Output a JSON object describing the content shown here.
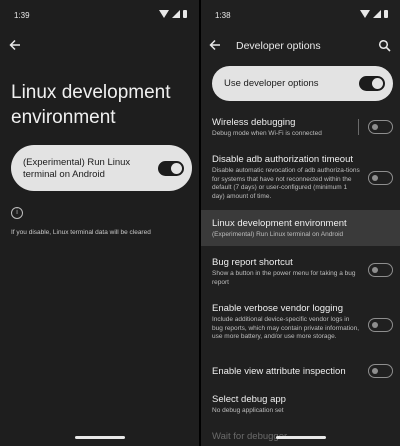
{
  "left": {
    "status_time": "1:39",
    "title": "Linux development environment",
    "toggle_label": "(Experimental) Run Linux terminal on Android",
    "info_text": "If you disable, Linux terminal data will be cleared"
  },
  "right": {
    "status_time": "1:38",
    "title": "Developer options",
    "dev_toggle_label": "Use developer options",
    "items": [
      {
        "title": "Wireless debugging",
        "subtitle": "Debug mode when Wi-Fi is connected"
      },
      {
        "title": "Disable adb authorization timeout",
        "subtitle": "Disable automatic revocation of adb authoriza-tions for systems that have not reconnected within the default (7 days) or user-configured (minimum 1 day) amount of time."
      },
      {
        "title": "Linux development environment",
        "subtitle": "(Experimental) Run Linux terminal on Android"
      },
      {
        "title": "Bug report shortcut",
        "subtitle": "Show a button in the power menu for taking a bug report"
      },
      {
        "title": "Enable verbose vendor logging",
        "subtitle": "Include additional device-specific vendor logs in bug reports, which may contain private information, use more battery, and/or use more storage."
      },
      {
        "title": "Enable view attribute inspection",
        "subtitle": ""
      },
      {
        "title": "Select debug app",
        "subtitle": "No debug application set"
      },
      {
        "title": "Wait for debugger",
        "subtitle": ""
      }
    ]
  }
}
